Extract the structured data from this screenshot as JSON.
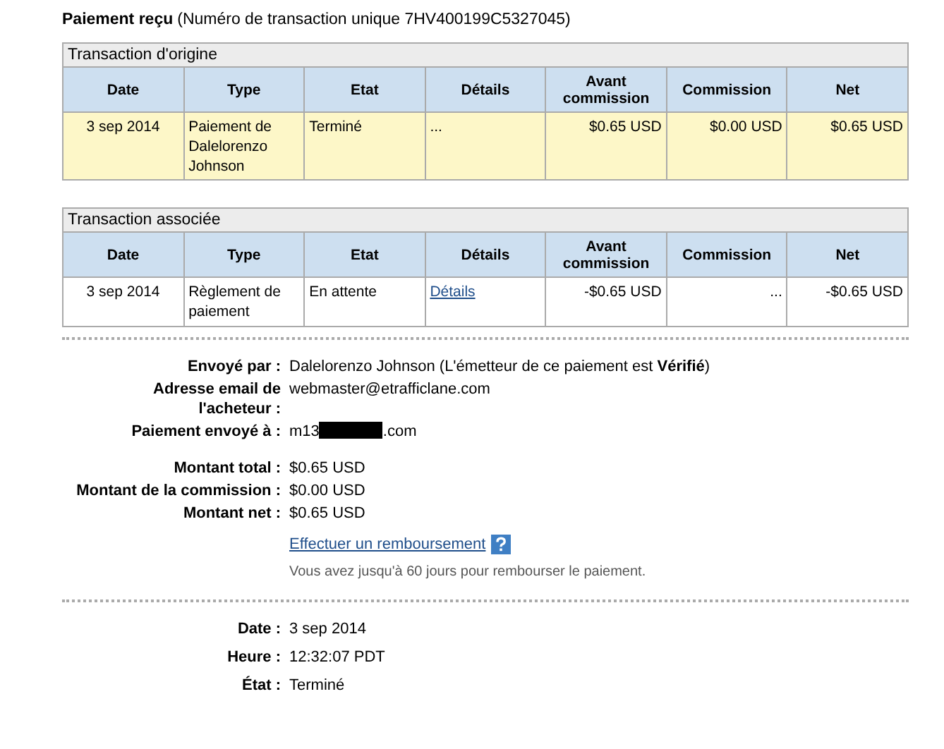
{
  "heading": {
    "title": "Paiement reçu",
    "detail": "(Numéro de transaction unique 7HV400199C5327045)"
  },
  "tables": [
    {
      "title": "Transaction d'origine",
      "columns": [
        "Date",
        "Type",
        "Etat",
        "Détails",
        "Avant commission",
        "Commission",
        "Net"
      ],
      "rows": [
        {
          "highlighted": true,
          "cells": [
            {
              "kind": "text",
              "text": "3 sep 2014"
            },
            {
              "kind": "text",
              "text": "Paiement de Dalelorenzo Johnson"
            },
            {
              "kind": "text",
              "text": "Terminé"
            },
            {
              "kind": "text",
              "text": "..."
            },
            {
              "kind": "text",
              "text": "$0.65 USD"
            },
            {
              "kind": "text",
              "text": "$0.00 USD"
            },
            {
              "kind": "text",
              "text": "$0.65 USD"
            }
          ]
        }
      ]
    },
    {
      "title": "Transaction associée",
      "columns": [
        "Date",
        "Type",
        "Etat",
        "Détails",
        "Avant commission",
        "Commission",
        "Net"
      ],
      "rows": [
        {
          "highlighted": false,
          "cells": [
            {
              "kind": "text",
              "text": "3 sep 2014"
            },
            {
              "kind": "text",
              "text": "Règlement de paiement"
            },
            {
              "kind": "text",
              "text": "En attente"
            },
            {
              "kind": "link",
              "text": "Détails"
            },
            {
              "kind": "text",
              "text": "-$0.65 USD"
            },
            {
              "kind": "text",
              "text": "..."
            },
            {
              "kind": "text",
              "text": "-$0.65 USD"
            }
          ]
        }
      ]
    }
  ],
  "sender_fields": [
    {
      "label": "Envoyé par :",
      "value": "Dalelorenzo Johnson (L'émetteur de ce paiement est **Vérifié**)",
      "redacted": false
    },
    {
      "label": "Adresse email de l'acheteur :",
      "value": "webmaster@etrafficlane.com",
      "redacted": false
    },
    {
      "label": "Paiement envoyé à :",
      "value": "m13",
      "value_end": ".com",
      "redacted": true
    }
  ],
  "amount_fields": [
    {
      "label": "Montant total :",
      "value": "$0.65 USD"
    },
    {
      "label": "Montant de la commission :",
      "value": "$0.00 USD"
    },
    {
      "label": "Montant net :",
      "value": "$0.65 USD"
    }
  ],
  "refund": {
    "link": "Effectuer un remboursement",
    "note": "Vous avez jusqu'à 60 jours pour rembourser le paiement."
  },
  "date_fields": [
    {
      "label": "Date :",
      "value": "3 sep 2014"
    },
    {
      "label": "Heure :",
      "value": "12:32:07 PDT"
    },
    {
      "label": "État :",
      "value": "Terminé"
    }
  ]
}
